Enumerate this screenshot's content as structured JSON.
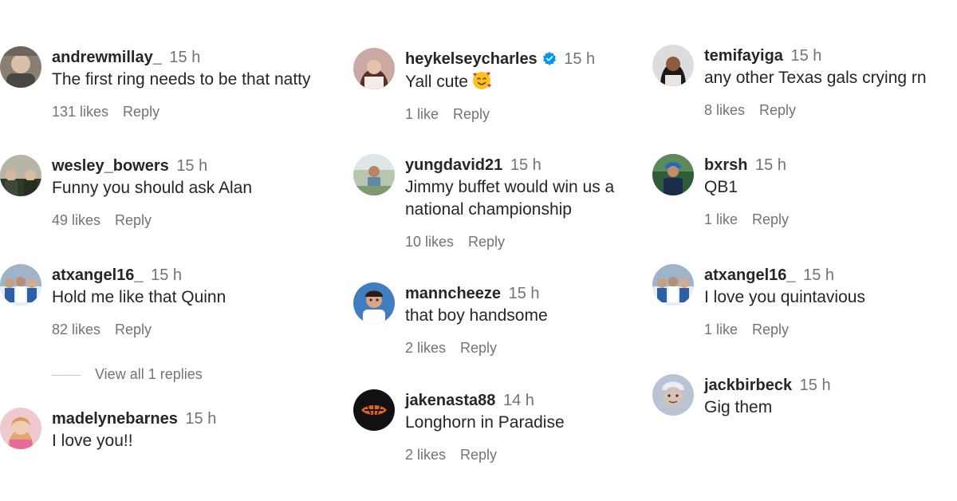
{
  "columns": [
    {
      "comments": [
        {
          "username": "andrewmillay_",
          "time": "15 h",
          "text": "The first ring needs to be that natty",
          "likes": "131 likes",
          "reply": "Reply"
        },
        {
          "username": "wesley_bowers",
          "time": "15 h",
          "text": "Funny you should ask Alan",
          "likes": "49 likes",
          "reply": "Reply"
        },
        {
          "username": "atxangel16_",
          "time": "15 h",
          "text": "Hold me like that Quinn",
          "likes": "82 likes",
          "reply": "Reply",
          "view_replies": "View all 1 replies"
        },
        {
          "username": "madelynebarnes",
          "time": "15 h",
          "text": "I love you!!"
        }
      ]
    },
    {
      "comments": [
        {
          "username": "heykelseycharles",
          "verified": true,
          "time": "15 h",
          "text": "Yall cute",
          "emoji": "smiling-face-with-hearts",
          "likes": "1 like",
          "reply": "Reply"
        },
        {
          "username": "yungdavid21",
          "time": "15 h",
          "text": "Jimmy buffet would win us a national championship",
          "likes": "10 likes",
          "reply": "Reply"
        },
        {
          "username": "manncheeze",
          "time": "15 h",
          "text": "that boy handsome",
          "likes": "2 likes",
          "reply": "Reply"
        },
        {
          "username": "jakenasta88",
          "time": "14 h",
          "text": "Longhorn in Paradise",
          "likes": "2 likes",
          "reply": "Reply"
        }
      ]
    },
    {
      "comments": [
        {
          "username": "temifayiga",
          "time": "15 h",
          "text": "any other Texas gals crying rn",
          "likes": "8 likes",
          "reply": "Reply"
        },
        {
          "username": "bxrsh",
          "time": "15 h",
          "text": "QB1",
          "likes": "1 like",
          "reply": "Reply"
        },
        {
          "username": "atxangel16_",
          "time": "15 h",
          "text": "I love you quintavious",
          "likes": "1 like",
          "reply": "Reply"
        },
        {
          "username": "jackbirbeck",
          "time": "15 h",
          "text": "Gig them"
        }
      ]
    }
  ],
  "colors": {
    "text": "#262626",
    "secondary": "#737373",
    "verified": "#0095f6"
  }
}
